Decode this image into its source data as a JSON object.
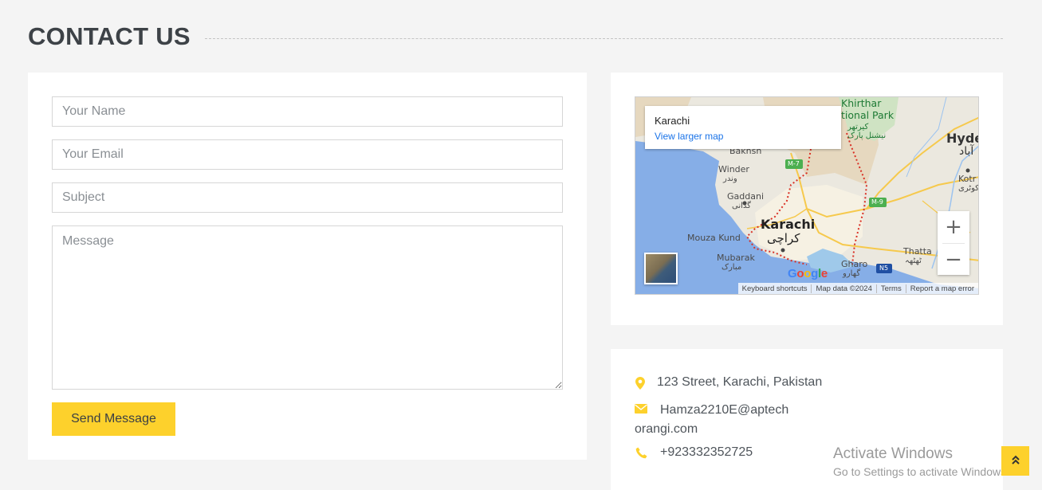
{
  "page": {
    "title": "CONTACT US"
  },
  "form": {
    "name_placeholder": "Your Name",
    "email_placeholder": "Your Email",
    "subject_placeholder": "Subject",
    "message_placeholder": "Message",
    "send_label": "Send Message"
  },
  "map": {
    "infobox_title": "Karachi",
    "infobox_link": "View larger map",
    "zoom_in": "+",
    "zoom_out": "−",
    "attribution": {
      "shortcuts": "Keyboard shortcuts",
      "data": "Map data ©2024",
      "terms": "Terms",
      "report": "Report a map error"
    },
    "logo": "Google",
    "labels": {
      "karachi": "Karachi",
      "karachi_ur": "کراچی",
      "khirthar_1": "Khirthar",
      "khirthar_2": "tional Park",
      "khirthar_ur": "کیرتھر\nنیشنل پارک",
      "hyde": "Hyde",
      "hyde_ur": "آباد",
      "kotri": "Kotr",
      "kotri_ur": "کوٹری",
      "bakhsh": "Bakhsh",
      "winder": "Winder",
      "winder_ur": "وندر",
      "gaddani": "Gaddani",
      "gaddani_ur": "گڈانی",
      "mouza_kund": "Mouza Kund",
      "mubarak": "Mubarak",
      "mubarak_ur": "مبارک",
      "gharo": "Gharo",
      "gharo_ur": "گھارو",
      "thatta": "Thatta",
      "thatta_ur": "ٹھٹھہ",
      "m7": "M-7",
      "m9": "M-9",
      "n5": "N5"
    }
  },
  "contact": {
    "address": "123 Street, Karachi, Pakistan",
    "email_line1": "Hamza2210E@aptech",
    "email_line2": "orangi.com",
    "phone": "+923332352725"
  },
  "overlay": {
    "activate_title": "Activate Windows",
    "activate_sub": "Go to Settings to activate Windows."
  },
  "colors": {
    "accent": "#fdd12c",
    "background": "#f4f4f4",
    "card": "#ffffff",
    "link": "#1a73e8"
  },
  "icons": {
    "address": "map-marker-icon",
    "email": "envelope-icon",
    "phone": "phone-icon",
    "back_to_top": "double-chevron-up-icon"
  }
}
